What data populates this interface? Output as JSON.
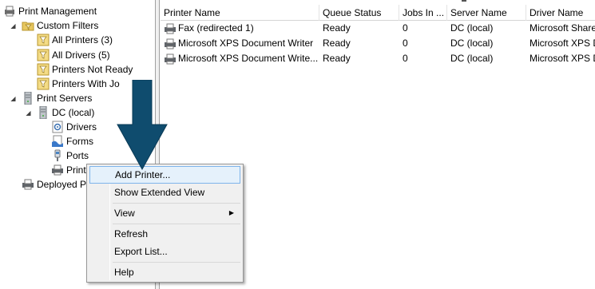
{
  "tree": {
    "items": [
      {
        "label": "Print Management",
        "icon": "print-management-icon",
        "twisty": ""
      },
      {
        "label": "Custom Filters",
        "icon": "filter-folder-icon",
        "twisty": "expanded"
      },
      {
        "label": "All Printers (3)",
        "icon": "filter-icon",
        "twisty": ""
      },
      {
        "label": "All Drivers (5)",
        "icon": "filter-icon",
        "twisty": ""
      },
      {
        "label": "Printers Not Ready",
        "icon": "filter-icon",
        "twisty": ""
      },
      {
        "label": "Printers With Jo",
        "icon": "filter-icon",
        "twisty": ""
      },
      {
        "label": "Print Servers",
        "icon": "server-icon",
        "twisty": "expanded"
      },
      {
        "label": "DC (local)",
        "icon": "server-icon",
        "twisty": "expanded"
      },
      {
        "label": "Drivers",
        "icon": "drivers-icon",
        "twisty": ""
      },
      {
        "label": "Forms",
        "icon": "forms-icon",
        "twisty": ""
      },
      {
        "label": "Ports",
        "icon": "ports-icon",
        "twisty": ""
      },
      {
        "label": "Print",
        "icon": "printer-icon",
        "twisty": ""
      },
      {
        "label": "Deployed P",
        "icon": "printer-icon",
        "twisty": ""
      }
    ]
  },
  "list": {
    "columns": [
      "Printer Name",
      "Queue Status",
      "Jobs In ...",
      "Server Name",
      "Driver Name"
    ],
    "rows": [
      {
        "name": "Fax (redirected 1)",
        "status": "Ready",
        "jobs": "0",
        "server": "DC (local)",
        "driver": "Microsoft Share"
      },
      {
        "name": "Microsoft XPS Document Writer",
        "status": "Ready",
        "jobs": "0",
        "server": "DC (local)",
        "driver": "Microsoft XPS D"
      },
      {
        "name": "Microsoft XPS Document Write...",
        "status": "Ready",
        "jobs": "0",
        "server": "DC (local)",
        "driver": "Microsoft XPS D"
      }
    ]
  },
  "menu": {
    "add_printer": "Add Printer...",
    "show_extended": "Show Extended View",
    "view": "View",
    "view_arrow": "▶",
    "refresh": "Refresh",
    "export": "Export List...",
    "help": "Help"
  },
  "colors": {
    "arrow": "#0f4c6e",
    "menu_highlight": "#e5f1fb",
    "menu_highlight_border": "#7eb4ea"
  }
}
